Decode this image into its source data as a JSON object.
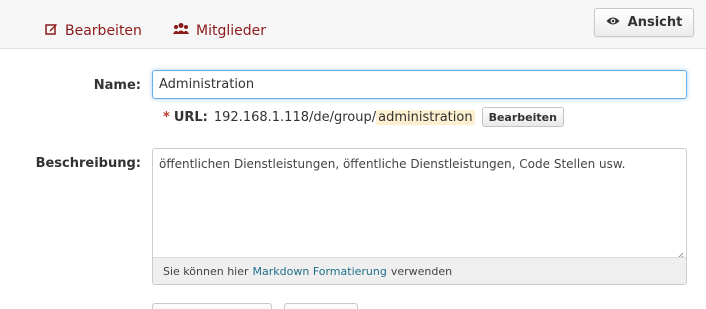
{
  "toolbar": {
    "edit_label": "Bearbeiten",
    "members_label": "Mitglieder",
    "view_label": "Ansicht"
  },
  "form": {
    "name_label": "Name:",
    "name_value": "Administration",
    "url_label": "URL:",
    "url_prefix": "192.168.1.118/de/group/",
    "url_slug": "administration",
    "url_edit_label": "Bearbeiten",
    "description_label": "Beschreibung:",
    "description_value": "öffentlichen Dienstleistungen, öffentliche Dienstleistungen, Code Stellen usw.",
    "markdown_hint_before": "Sie können hier",
    "markdown_link": "Markdown Formatierung",
    "markdown_hint_after": "verwenden"
  },
  "colors": {
    "tab_text": "#8b1a1a",
    "input_focus": "#66afe9",
    "required_star": "#c0392b",
    "link": "#1f6f8b",
    "slug_highlight": "#fdf0d0"
  },
  "icons": {
    "edit": "edit-icon",
    "members": "users-icon",
    "view": "eye-icon"
  }
}
